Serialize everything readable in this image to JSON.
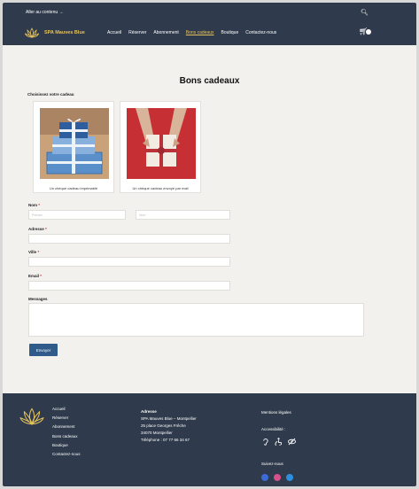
{
  "skip_link": "Aller au contenu →",
  "brand": {
    "name": "SPA Mauves Blue",
    "accent": "#e5c25c",
    "navy": "#2f3b4c"
  },
  "nav": {
    "items": [
      "Accueil",
      "Réserver",
      "Abonnement",
      "Bons cadeaux",
      "Boutique",
      "Contactez-nous"
    ],
    "active": "Bons cadeaux"
  },
  "page": {
    "title": "Bons cadeaux",
    "choose_label": "Choisissez votre cadeau"
  },
  "gifts": [
    {
      "caption": "Un chèque cadeau imprimable"
    },
    {
      "caption": "Un chèque cadeau envoyé par mail"
    }
  ],
  "form": {
    "nom_label": "Nom",
    "nom_first_placeholder": "Prénom",
    "nom_last_placeholder": "Nom",
    "adresse_label": "Adresse",
    "ville_label": "Ville",
    "email_label": "Email",
    "message_label": "Messages",
    "submit_label": "Envoyer"
  },
  "footer": {
    "links": [
      "Accueil",
      "Réserver",
      "Abonnement",
      "Bons cadeaux",
      "Boutique",
      "Contactez-nous"
    ],
    "address_title": "Adresse",
    "address_lines": [
      "SPA Mauves Blue – Montpellier",
      "25 place Georges Frêche",
      "34070 Montpellier",
      "Téléphone : 07 77 66 34 67"
    ],
    "legal": "Mentions légales",
    "accessibility": "Accessibilité :",
    "follow": "Suivez-nous"
  }
}
